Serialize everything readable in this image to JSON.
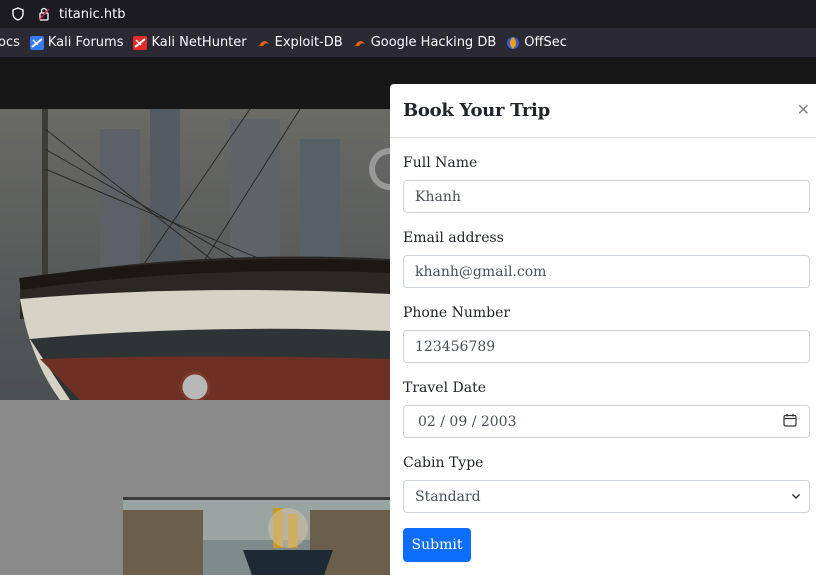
{
  "browser": {
    "url": "titanic.htb"
  },
  "bookmarks": [
    {
      "label": "ocs",
      "icon": "bookmark-fragment"
    },
    {
      "label": "Kali Forums",
      "icon": "kali-icon"
    },
    {
      "label": "Kali NetHunter",
      "icon": "nethunter-icon"
    },
    {
      "label": "Exploit-DB",
      "icon": "exploitdb-icon"
    },
    {
      "label": "Google Hacking DB",
      "icon": "exploitdb-icon"
    },
    {
      "label": "OffSec",
      "icon": "offsec-icon"
    }
  ],
  "modal": {
    "title": "Book Your Trip",
    "close_icon": "close-icon",
    "fields": {
      "full_name": {
        "label": "Full Name",
        "value": "Khanh"
      },
      "email": {
        "label": "Email address",
        "value": "khanh@gmail.com"
      },
      "phone": {
        "label": "Phone Number",
        "value": "123456789"
      },
      "travel_date": {
        "label": "Travel Date",
        "value": "02 / 09 / 2003"
      },
      "cabin_type": {
        "label": "Cabin Type",
        "value": "Standard"
      }
    },
    "submit_label": "Submit"
  },
  "colors": {
    "primary": "#0d6efd",
    "browser_bg": "#1c1b22",
    "toolbar_bg": "#2b2a33"
  }
}
